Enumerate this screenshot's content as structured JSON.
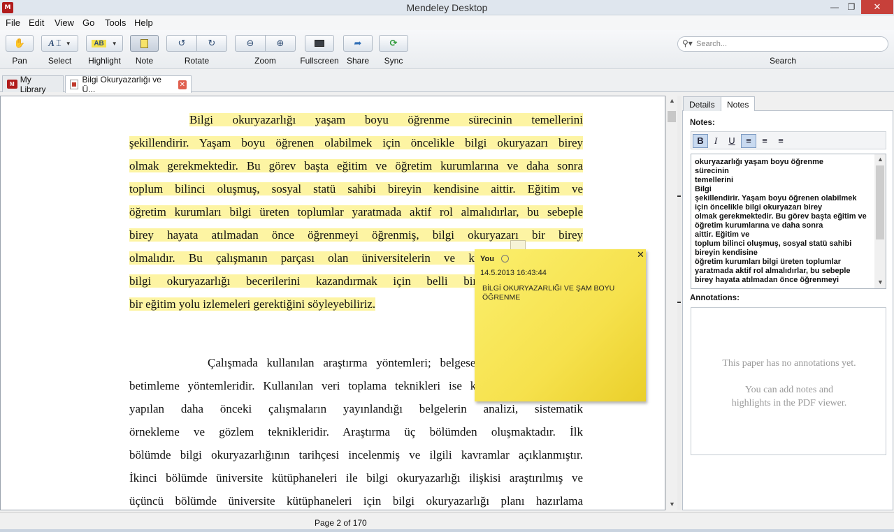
{
  "window": {
    "title": "Mendeley Desktop",
    "app_icon": "mendeley-logo",
    "controls": {
      "minimize": "—",
      "maximize": "❐",
      "close": "✕"
    }
  },
  "menu": [
    "File",
    "Edit",
    "View",
    "Go",
    "Tools",
    "Help"
  ],
  "toolbar": {
    "pan": "Pan",
    "select": "Select",
    "highlight": "Highlight",
    "note": "Note",
    "rotate": "Rotate",
    "zoom": "Zoom",
    "fullscreen": "Fullscreen",
    "share": "Share",
    "sync": "Sync",
    "search_label": "Search",
    "search_placeholder": "Search..."
  },
  "tabs": {
    "library": "My Library",
    "document": "Bilgi Okuryazarlığı ve Ü..."
  },
  "document": {
    "paragraph1": [
      "Bilgi okuryazarlığı yaşam boyu öğrenme sürecinin temellerini",
      "şekillendirir. Yaşam boyu öğrenen olabilmek için öncelikle bilgi okuryazarı birey",
      "olmak gerekmektedir. Bu görev başta eğitim ve öğretim kurumlarına ve daha sonra",
      "toplum bilinci oluşmuş, sosyal statü sahibi bireyin kendisine aittir. Eğitim ve",
      "öğretim kurumları bilgi üreten toplumlar yaratmada aktif rol almalıdırlar, bu sebeple",
      "birey hayata atılmadan önce öğrenmeyi öğrenmiş, bilgi okuryazarı bir birey",
      "olmalıdır. Bu çalışmanın parçası olan üniversitelerin ve kütüphanelerin bireye",
      "bilgi okuryazarlığı becerilerini kazandırmak için belli bir sistem dahilinde",
      "bir eğitim yolu izlemeleri gerektiğini söyleyebiliriz."
    ],
    "paragraph2": [
      "Çalışmada kullanılan araştırma yöntemleri; belgesel kaynak analizi ve",
      "betimleme yöntemleridir. Kullanılan veri toplama teknikleri ise konu ile ilgili olarak",
      "yapılan daha önceki çalışmaların yayınlandığı belgelerin analizi, sistematik",
      "örnekleme ve gözlem teknikleridir. Araştırma üç bölümden oluşmaktadır. İlk",
      "bölümde bilgi okuryazarlığının tarihçesi incelenmiş ve ilgili kavramlar açıklanmıştır.",
      "İkinci bölümde üniversite kütüphaneleri ile bilgi okuryazarlığı ilişkisi araştırılmış ve",
      "üçüncü bölümde üniversite kütüphaneleri için bilgi okuryazarlığı planı hazırlama"
    ]
  },
  "sticky_note": {
    "author": "You",
    "date": "14.5.2013 16:43:44",
    "text": "BİLGİ OKURYAZARLIĞI VE ŞAM BOYU ÖĞRENME",
    "close": "✕"
  },
  "right_panel": {
    "tabs": [
      "Details",
      "Notes"
    ],
    "notes_label": "Notes:",
    "format_buttons": [
      "B",
      "I",
      "U"
    ],
    "notes_text": "okuryazarlığı yaşam boyu öğrenme\nsürecinin\ntemellerini\nBilgi\nşekillendirir. Yaşam boyu öğrenen olabilmek için öncelikle bilgi okuryazarı birey\nolmak gerekmektedir. Bu görev başta eğitim ve öğretim kurumlarına ve daha sonra\naittir. Eğitim ve\ntoplum bilinci oluşmuş, sosyal statü sahibi bireyin kendisine\nöğretim kurumları bilgi üreten toplumlar yaratmada aktif rol almalıdırlar, bu sebeple\nbirey hayata atılmadan önce öğrenmeyi",
    "annotations_label": "Annotations:",
    "annotations_empty_1": "This paper has no annotations yet.",
    "annotations_empty_2": "You can add notes and highlights in the PDF viewer."
  },
  "status": {
    "page": "Page 2 of 170"
  },
  "colors": {
    "highlight": "#fdf4a3",
    "sticky": "#f6e14c",
    "accent": "#b11c1c"
  }
}
